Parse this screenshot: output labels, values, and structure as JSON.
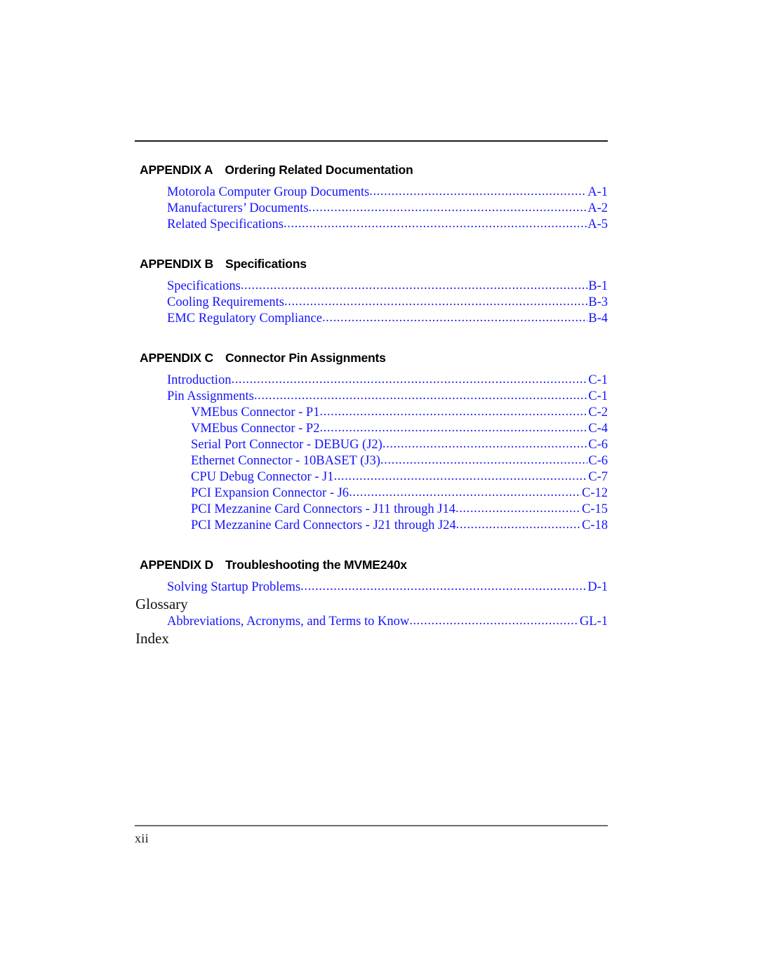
{
  "document": {
    "folio": "xii"
  },
  "sections": [
    {
      "kind": "appendix",
      "label": "APPENDIX A",
      "title": "Ordering Related Documentation",
      "entries": [
        {
          "level": 1,
          "title": "Motorola Computer Group Documents",
          "page": "A-1"
        },
        {
          "level": 1,
          "title": "Manufacturers’ Documents",
          "page": "A-2"
        },
        {
          "level": 1,
          "title": "Related Specifications",
          "page": "A-5"
        }
      ]
    },
    {
      "kind": "appendix",
      "label": "APPENDIX B",
      "title": "Specifications",
      "entries": [
        {
          "level": 1,
          "title": "Specifications",
          "page": "B-1"
        },
        {
          "level": 1,
          "title": "Cooling Requirements",
          "page": "B-3"
        },
        {
          "level": 1,
          "title": "EMC Regulatory Compliance",
          "page": "B-4"
        }
      ]
    },
    {
      "kind": "appendix",
      "label": "APPENDIX C",
      "title": "Connector Pin Assignments",
      "entries": [
        {
          "level": 1,
          "title": "Introduction",
          "page": "C-1"
        },
        {
          "level": 1,
          "title": "Pin Assignments",
          "page": "C-1"
        },
        {
          "level": 2,
          "title": "VMEbus Connector - P1",
          "page": "C-2"
        },
        {
          "level": 2,
          "title": "VMEbus Connector - P2",
          "page": "C-4"
        },
        {
          "level": 2,
          "title": "Serial Port Connector - DEBUG (J2)",
          "page": "C-6"
        },
        {
          "level": 2,
          "title": "Ethernet Connector - 10BASET (J3)",
          "page": "C-6"
        },
        {
          "level": 2,
          "title": "CPU Debug Connector - J1",
          "page": "C-7"
        },
        {
          "level": 2,
          "title": "PCI Expansion Connector - J6",
          "page": "C-12"
        },
        {
          "level": 2,
          "title": "PCI Mezzanine Card Connectors - J11 through J14",
          "page": "C-15"
        },
        {
          "level": 2,
          "title": "PCI Mezzanine Card Connectors - J21 through J24",
          "page": "C-18"
        }
      ]
    },
    {
      "kind": "appendix",
      "label": "APPENDIX D",
      "title": "Troubleshooting the MVME240x",
      "entries": [
        {
          "level": 1,
          "title": "Solving Startup Problems",
          "page": "D-1"
        }
      ]
    },
    {
      "kind": "plain",
      "label": "Glossary",
      "title": "",
      "entries": [
        {
          "level": 1,
          "title": "Abbreviations, Acronyms, and Terms to Know",
          "page": "GL-1"
        }
      ]
    },
    {
      "kind": "plain",
      "label": "Index",
      "title": "",
      "entries": []
    }
  ]
}
